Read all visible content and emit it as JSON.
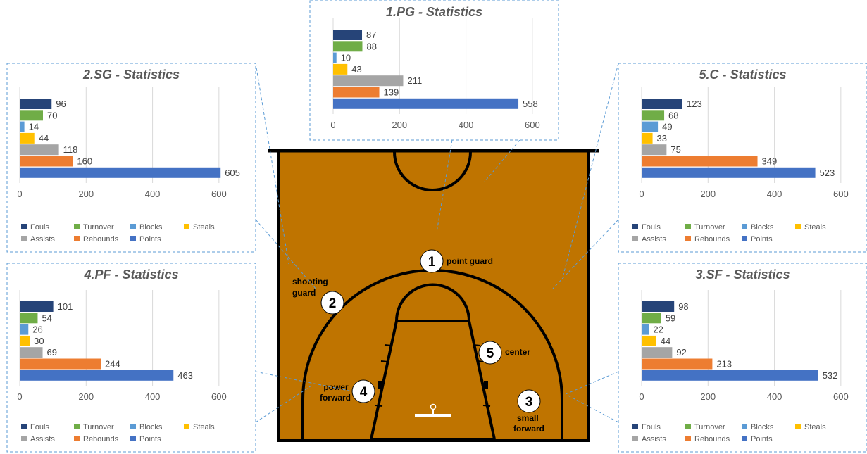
{
  "court": {
    "positions": [
      {
        "number": "1",
        "label": "point guard"
      },
      {
        "number": "2",
        "label": "shooting guard"
      },
      {
        "number": "3",
        "label": "small forward"
      },
      {
        "number": "4",
        "label": "power forward"
      },
      {
        "number": "5",
        "label": "center"
      }
    ]
  },
  "colors": {
    "court": "#BF7400",
    "Fouls": "#264478",
    "Turnover": "#70AD47",
    "Blocks": "#5B9BD5",
    "Steals": "#FFC000",
    "Assists": "#A5A5A5",
    "Rebounds": "#ED7D31",
    "Points": "#4472C4"
  },
  "chart_data": [
    {
      "type": "bar",
      "title": "1.PG - Statistics",
      "categories": [
        "Fouls",
        "Turnover",
        "Blocks",
        "Steals",
        "Assists",
        "Rebounds",
        "Points"
      ],
      "values": [
        87,
        88,
        10,
        43,
        211,
        139,
        558
      ],
      "xlim": [
        0,
        700
      ],
      "xticks": [
        0,
        200,
        400,
        600
      ],
      "grid": true,
      "legend": "none"
    },
    {
      "type": "bar",
      "title": "2.SG - Statistics",
      "categories": [
        "Fouls",
        "Turnover",
        "Blocks",
        "Steals",
        "Assists",
        "Rebounds",
        "Points"
      ],
      "values": [
        96,
        70,
        14,
        44,
        118,
        160,
        605
      ],
      "xlim": [
        0,
        700
      ],
      "xticks": [
        0,
        200,
        400,
        600
      ],
      "grid": true,
      "legend": "bottom"
    },
    {
      "type": "bar",
      "title": "5.C - Statistics",
      "categories": [
        "Fouls",
        "Turnover",
        "Blocks",
        "Steals",
        "Assists",
        "Rebounds",
        "Points"
      ],
      "values": [
        123,
        68,
        49,
        33,
        75,
        349,
        523
      ],
      "xlim": [
        0,
        700
      ],
      "xticks": [
        0,
        200,
        400,
        600
      ],
      "grid": true,
      "legend": "bottom"
    },
    {
      "type": "bar",
      "title": "4.PF - Statistics",
      "categories": [
        "Fouls",
        "Turnover",
        "Blocks",
        "Steals",
        "Assists",
        "Rebounds",
        "Points"
      ],
      "values": [
        101,
        54,
        26,
        30,
        69,
        244,
        463
      ],
      "xlim": [
        0,
        700
      ],
      "xticks": [
        0,
        200,
        400,
        600
      ],
      "grid": true,
      "legend": "bottom"
    },
    {
      "type": "bar",
      "title": "3.SF - Statistics",
      "categories": [
        "Fouls",
        "Turnover",
        "Blocks",
        "Steals",
        "Assists",
        "Rebounds",
        "Points"
      ],
      "values": [
        98,
        59,
        22,
        44,
        92,
        213,
        532
      ],
      "xlim": [
        0,
        700
      ],
      "xticks": [
        0,
        200,
        400,
        600
      ],
      "grid": true,
      "legend": "bottom"
    }
  ]
}
